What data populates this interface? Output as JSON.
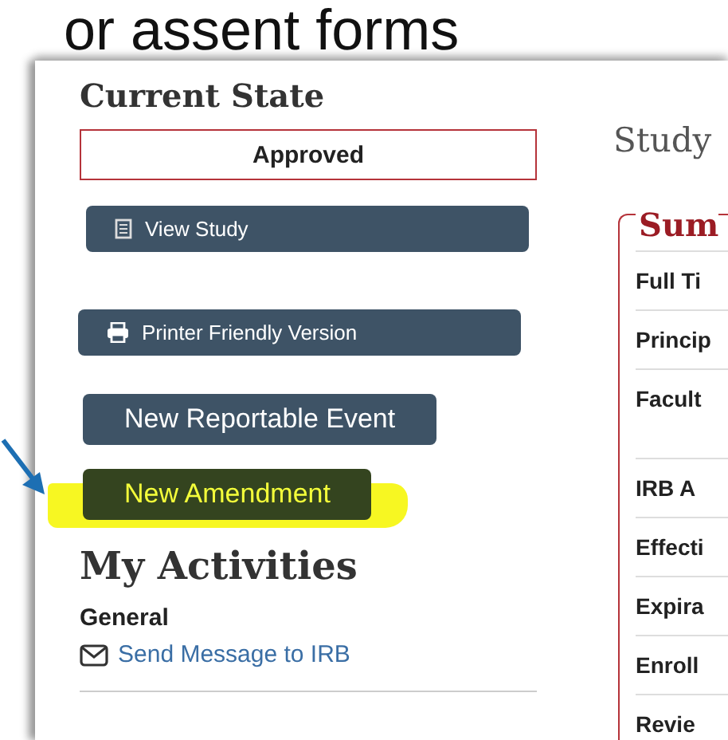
{
  "slide_heading": "or assent forms",
  "current_state": {
    "title": "Current State",
    "status": "Approved"
  },
  "buttons": [
    {
      "label": "View Study",
      "kind": "study",
      "highlighted": false
    },
    {
      "label": "Printer Friendly Version",
      "kind": "print",
      "highlighted": false
    },
    {
      "label": "New Reportable Event",
      "kind": "plain",
      "highlighted": false
    },
    {
      "label": "New Amendment",
      "kind": "plain",
      "highlighted": true
    }
  ],
  "activities": {
    "title": "My Activities",
    "group": "General",
    "link": "Send Message to IRB"
  },
  "study": {
    "title": "Study",
    "section": "Sum",
    "rows": [
      {
        "label": "Full Ti",
        "tall": false
      },
      {
        "label": "Princip",
        "tall": false
      },
      {
        "label": "Facult",
        "tall": true
      },
      {
        "label": "IRB A",
        "tall": false
      },
      {
        "label": "Effecti",
        "tall": false
      },
      {
        "label": "Expira",
        "tall": false
      },
      {
        "label": "Enroll",
        "tall": false
      },
      {
        "label": "Revie",
        "tall": false
      }
    ]
  }
}
